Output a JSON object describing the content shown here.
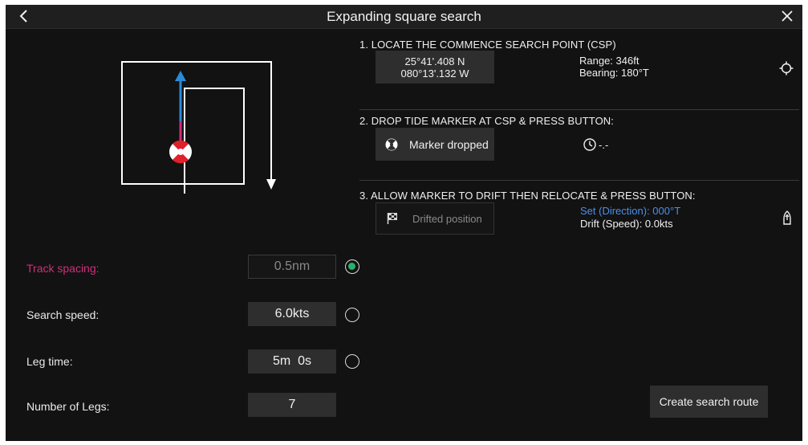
{
  "header": {
    "title": "Expanding square search",
    "back_icon": "chevron-left-icon",
    "close_icon": "close-icon"
  },
  "params": {
    "track_spacing": {
      "label": "Track spacing:",
      "value": "0.5nm",
      "selected": true
    },
    "search_speed": {
      "label": "Search speed:",
      "value": "6.0kts",
      "selected": false
    },
    "leg_time": {
      "label": "Leg time:",
      "value": "5m  0s",
      "selected": false
    },
    "number_of_legs": {
      "label": "Number of Legs:",
      "value": "7"
    }
  },
  "step1": {
    "heading": "1. LOCATE THE COMMENCE SEARCH POINT (CSP)",
    "lat": "25°41'.408 N",
    "lon": "080°13'.132 W",
    "range": "Range: 346ft",
    "bearing": "Bearing: 180°T",
    "locate_icon": "crosshair-icon"
  },
  "step2": {
    "heading": "2. DROP TIDE MARKER AT CSP & PRESS BUTTON:",
    "button_label": "Marker dropped",
    "button_icon": "lifebuoy-icon",
    "timer_icon": "clock-icon",
    "timer_value": "-.-"
  },
  "step3": {
    "heading": "3. ALLOW MARKER TO DRIFT THEN RELOCATE & PRESS BUTTON:",
    "button_label": "Drifted position",
    "button_icon": "checkered-flag-icon",
    "set_direction": "Set (Direction): 000°T",
    "drift_speed": "Drift (Speed): 0.0kts",
    "vessel_icon": "vessel-icon"
  },
  "actions": {
    "create_route": "Create search route"
  },
  "colors": {
    "background": "#121212",
    "active_label": "#d02e7b",
    "radio_selected": "#26b36b",
    "link_blue": "#4d8ee8",
    "arrow_blue": "#2a8bd8",
    "button_bg": "#2e2e2e"
  }
}
